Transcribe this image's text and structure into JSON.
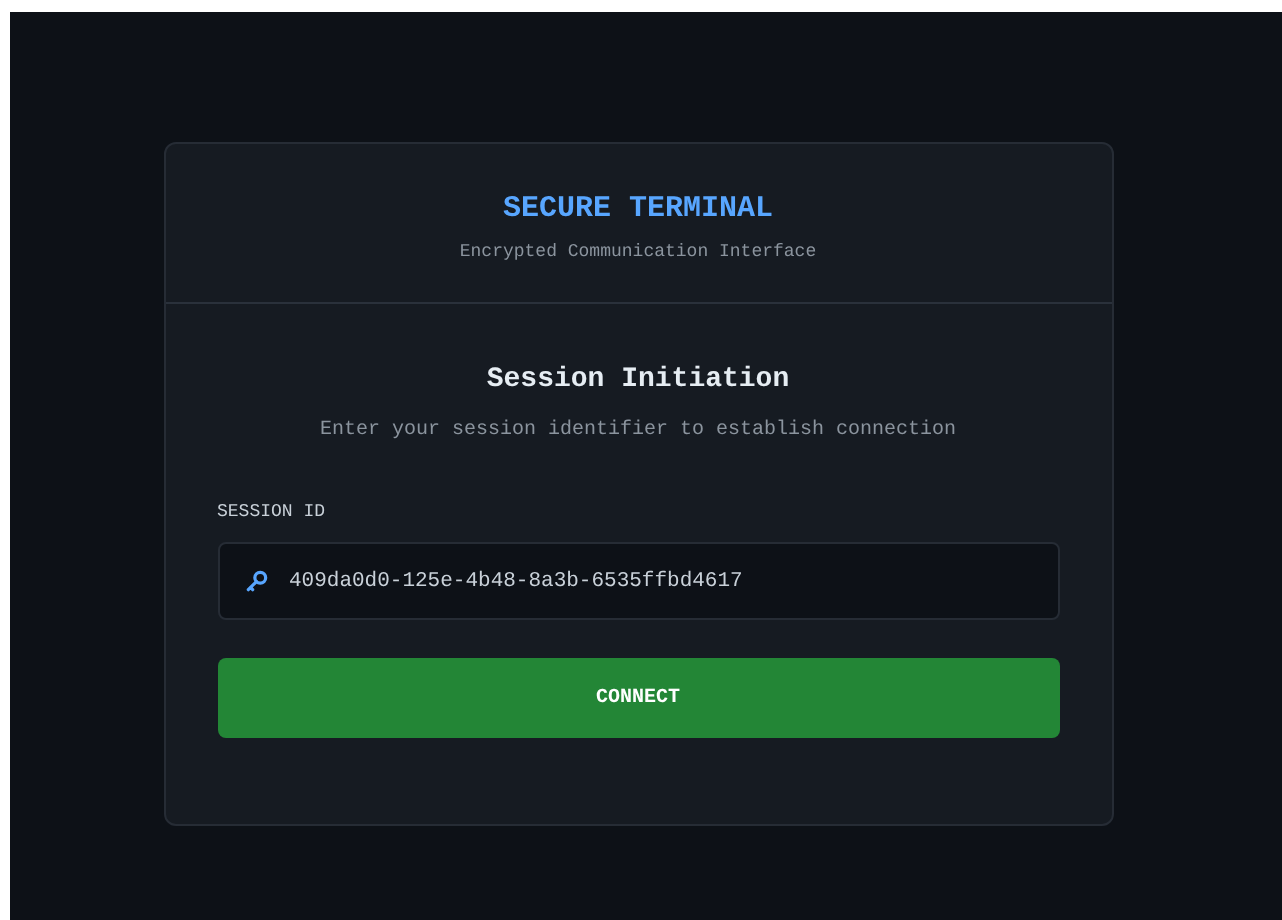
{
  "header": {
    "title": "SECURE TERMINAL",
    "subtitle": "Encrypted Communication Interface"
  },
  "session": {
    "title": "Session Initiation",
    "description": "Enter your session identifier to establish connection"
  },
  "field": {
    "label": "SESSION ID",
    "value": "409da0d0-125e-4b48-8a3b-6535ffbd4617"
  },
  "button": {
    "label": "CONNECT"
  }
}
